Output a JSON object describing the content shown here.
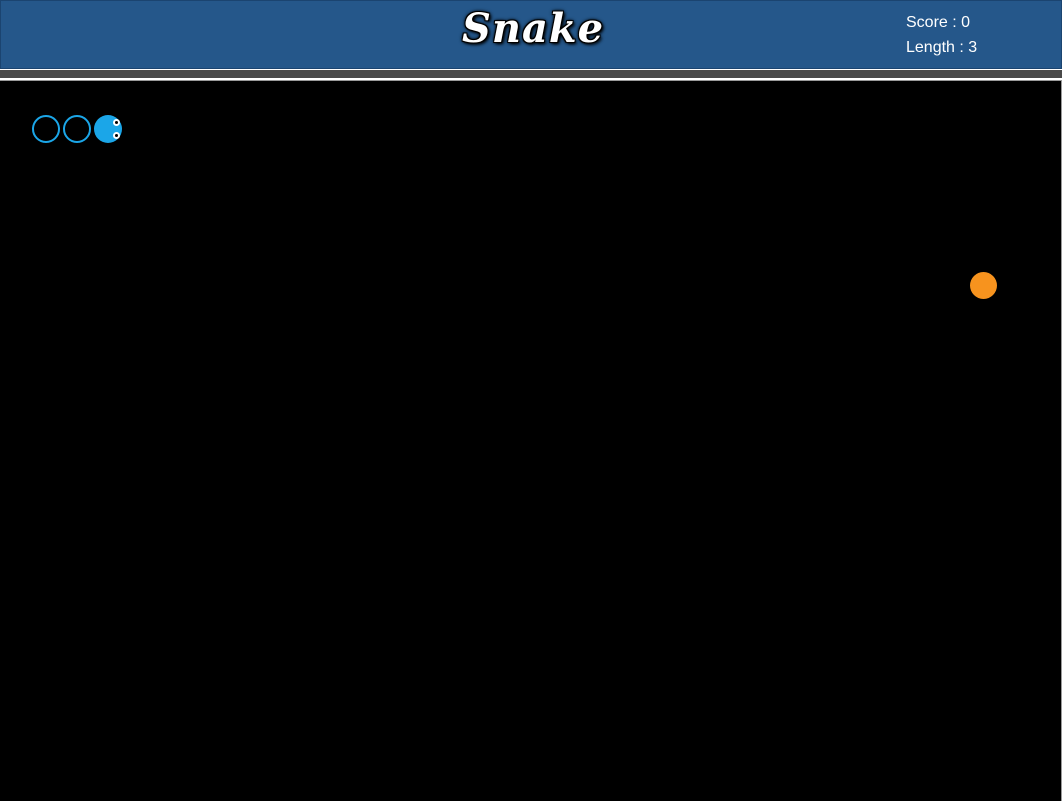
{
  "header": {
    "title": "Snake",
    "score_label": "Score : 0",
    "length_label": "Length : 3"
  },
  "game": {
    "score": 0,
    "length": 3,
    "direction": "right",
    "snake_color": "#1ba6e8",
    "food_color": "#f7931e",
    "background_color": "#000000",
    "header_color": "#25578a"
  }
}
